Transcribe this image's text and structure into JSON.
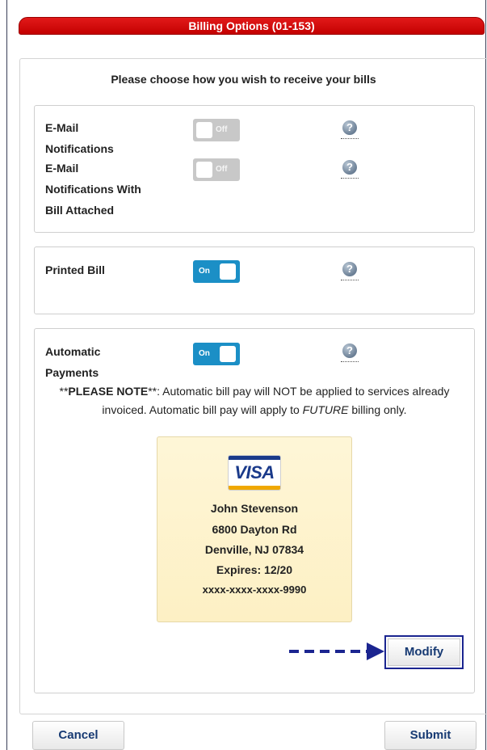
{
  "dialog": {
    "title": "Billing Options (01-153)",
    "instructions": "Please choose how you wish to receive your bills"
  },
  "options": {
    "email": {
      "label_line1": "E-Mail",
      "label_line2": "Notifications",
      "state": "Off"
    },
    "email_attached": {
      "label_line1": "E-Mail",
      "label_line2": "Notifications With",
      "label_line3": "Bill Attached",
      "state": "Off"
    },
    "printed": {
      "label": "Printed Bill",
      "state": "On"
    },
    "autopay": {
      "label_line1": "Automatic",
      "label_line2": "Payments",
      "state": "On"
    }
  },
  "help_icon": "question-circle-icon",
  "note": {
    "prefix": "**",
    "bold": "PLEASE NOTE",
    "suffix": "**: Automatic bill pay will NOT be applied to services already invoiced. Automatic bill pay will apply to ",
    "italic": "FUTURE",
    "end": " billing only."
  },
  "card": {
    "brand": "VISA",
    "name": "John Stevenson",
    "address1": "6800 Dayton Rd",
    "address2": "Denville, NJ 07834",
    "expires": "Expires: 12/20",
    "number": "xxxx-xxxx-xxxx-9990"
  },
  "buttons": {
    "modify": "Modify",
    "cancel": "Cancel",
    "submit": "Submit"
  },
  "colors": {
    "title_bar": "#d40000",
    "toggle_on": "#1b8fc6",
    "toggle_off": "#c8c8c8",
    "button_text": "#173a73",
    "card_background": "#fdf2c9",
    "highlight": "#1b2590"
  }
}
